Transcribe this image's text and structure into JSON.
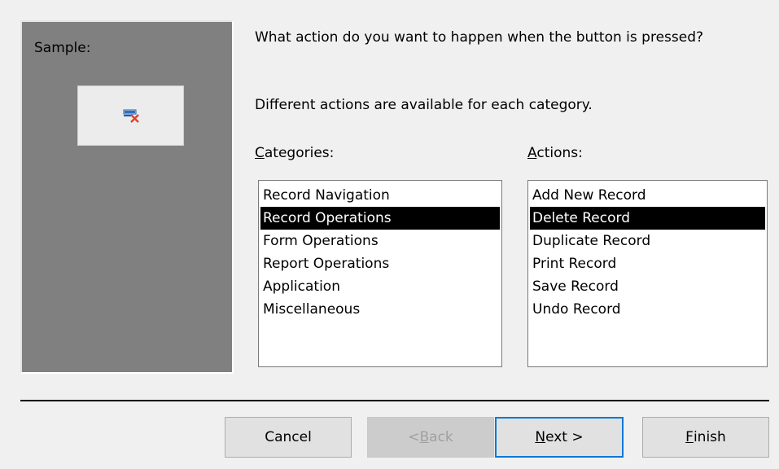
{
  "sample": {
    "label": "Sample:",
    "preview_icon": "delete-record-icon"
  },
  "question": "What action do you want to happen when the button is pressed?",
  "info": "Different actions are available for each category.",
  "categories": {
    "label_hotkey": "C",
    "label_rest": "ategories:",
    "items": [
      "Record Navigation",
      "Record Operations",
      "Form Operations",
      "Report Operations",
      "Application",
      "Miscellaneous"
    ],
    "selected_index": 1
  },
  "actions": {
    "label_hotkey": "A",
    "label_rest": "ctions:",
    "items": [
      "Add New Record",
      "Delete Record",
      "Duplicate Record",
      "Print Record",
      "Save Record",
      "Undo Record"
    ],
    "selected_index": 1
  },
  "buttons": {
    "cancel": "Cancel",
    "back_prefix": "< ",
    "back_hotkey": "B",
    "back_rest": "ack",
    "next_hotkey": "N",
    "next_rest": "ext >",
    "finish_hotkey": "F",
    "finish_rest": "inish"
  },
  "colors": {
    "selection": "#000000",
    "focus_border": "#0078d7",
    "sample_panel": "#808080"
  }
}
